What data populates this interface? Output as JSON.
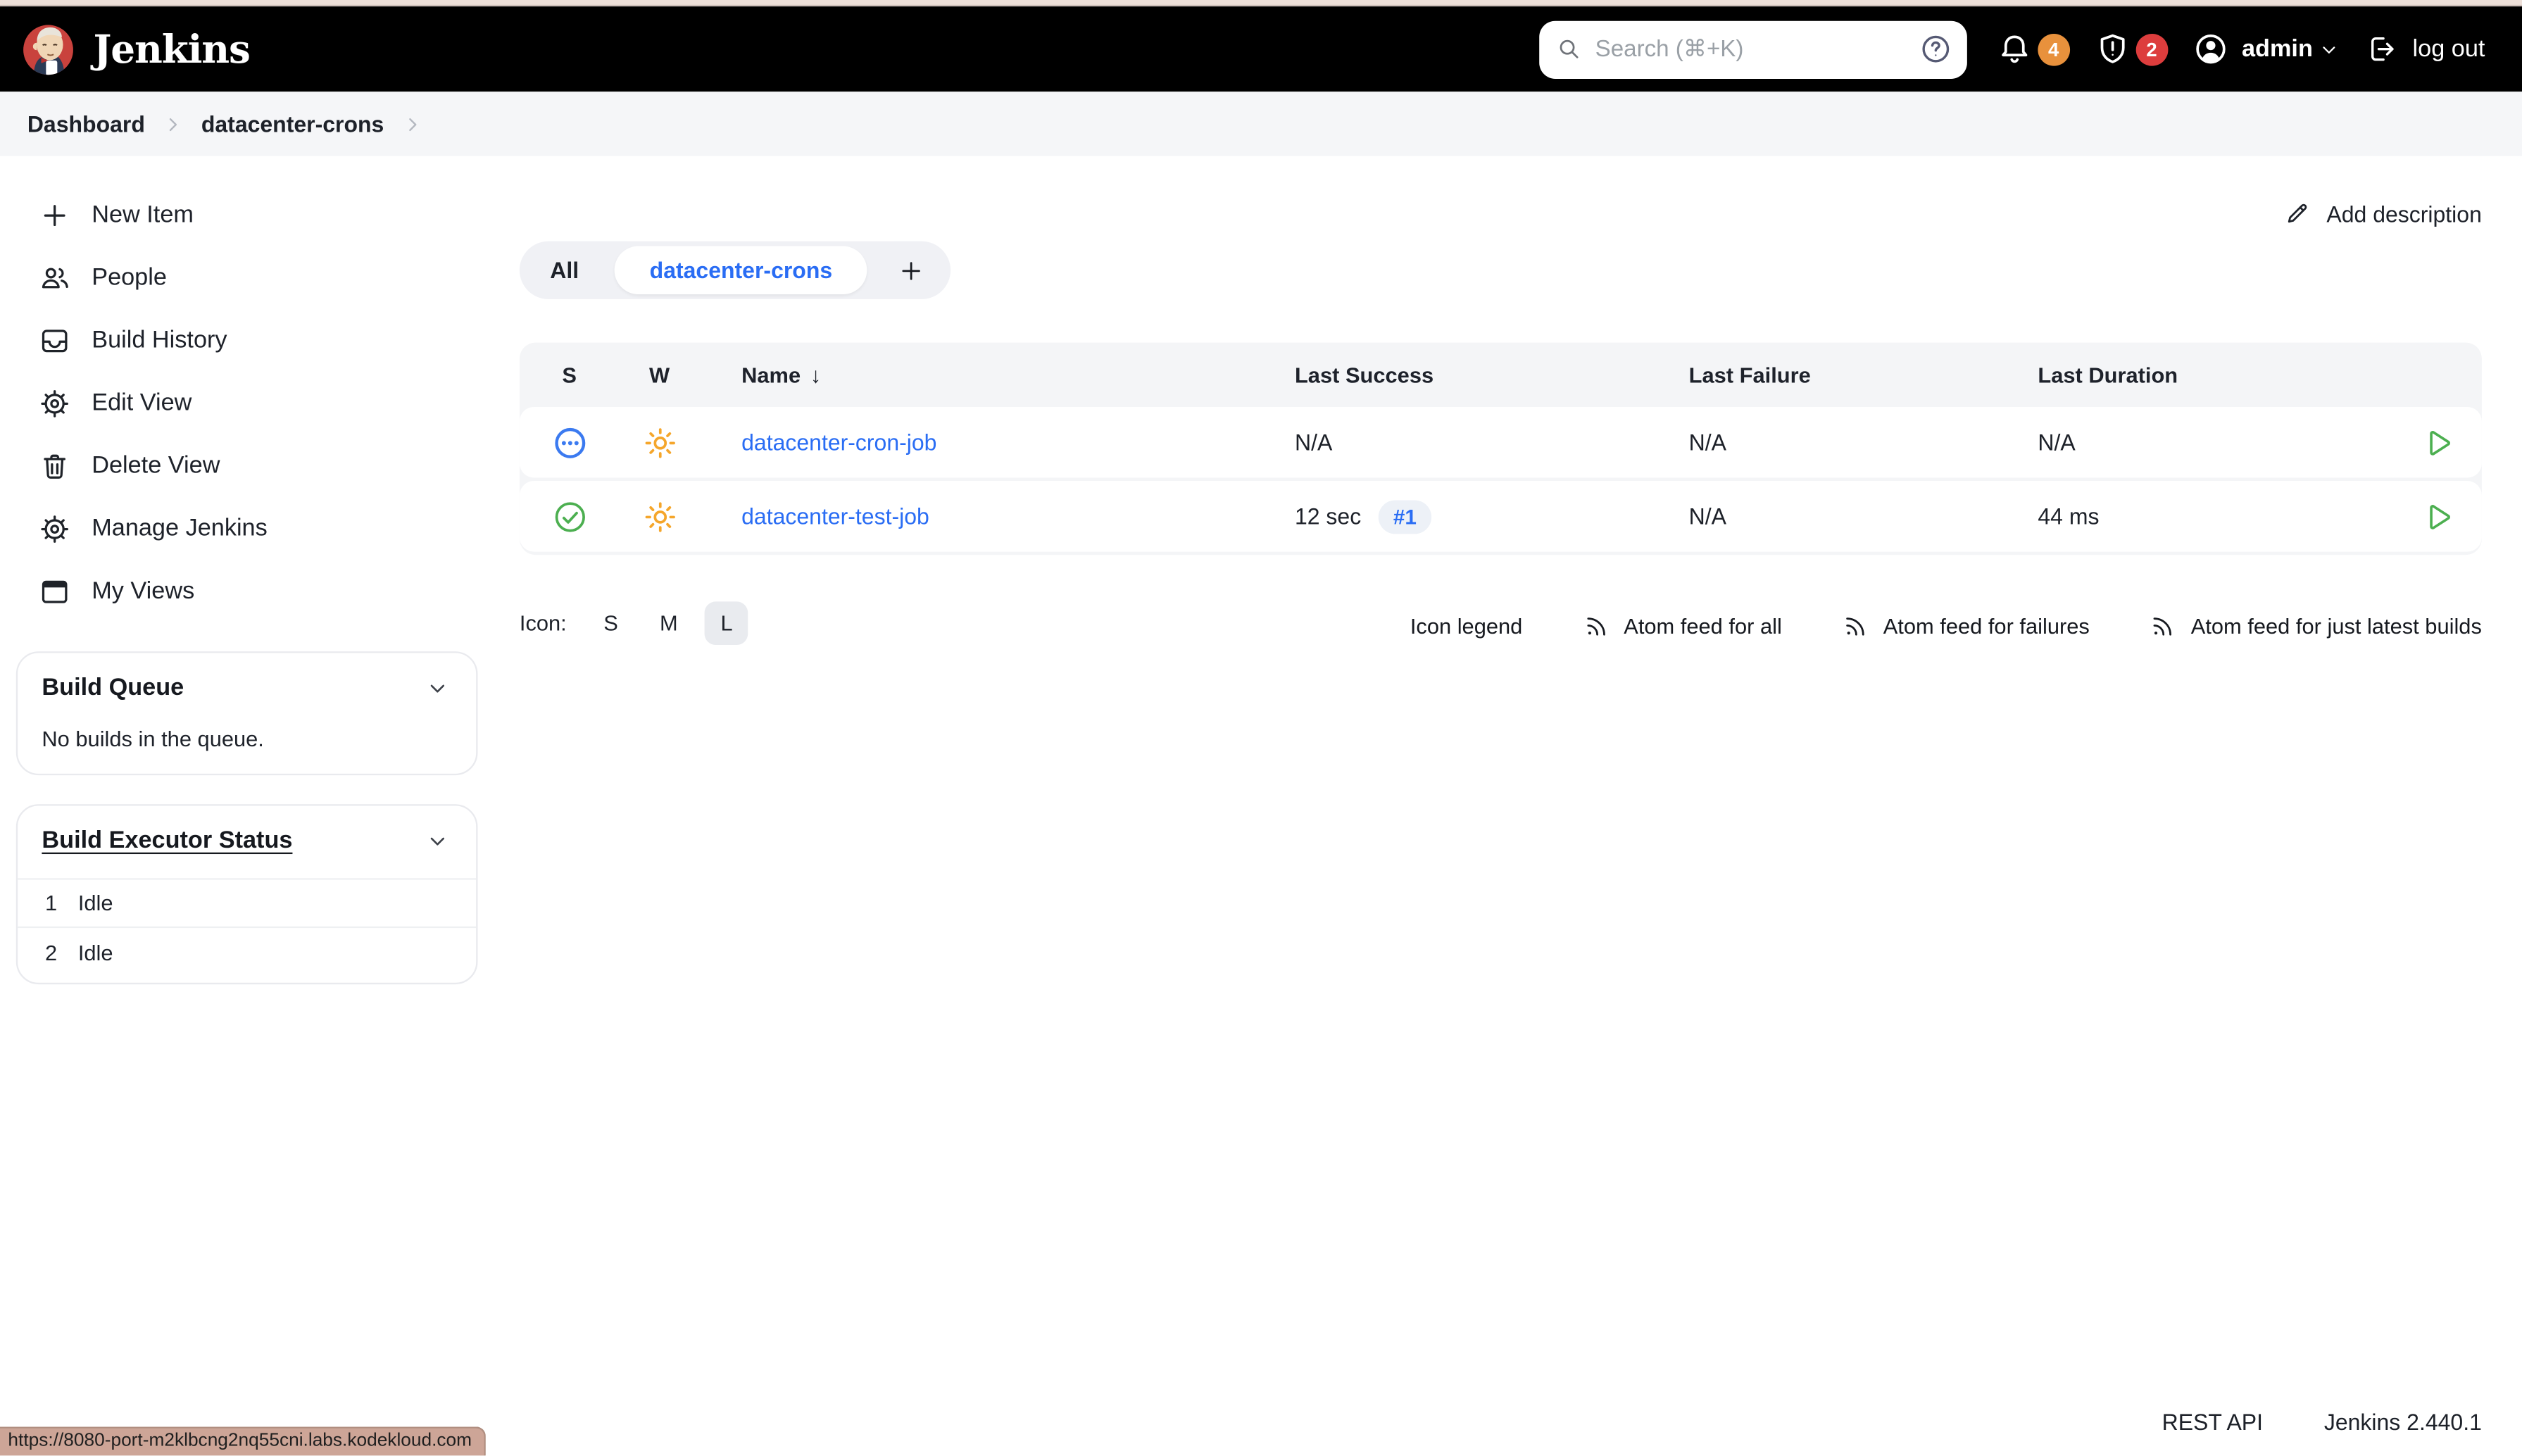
{
  "browser": {
    "status_url": "https://8080-port-m2klbcng2nq55cni.labs.kodekloud.com"
  },
  "header": {
    "brand": "Jenkins",
    "search_placeholder": "Search (⌘+K)",
    "notifications_count": "4",
    "security_warnings_count": "2",
    "user": "admin",
    "logout_label": "log out"
  },
  "breadcrumb": {
    "items": [
      "Dashboard",
      "datacenter-crons"
    ]
  },
  "sidebar": {
    "items": [
      {
        "label": "New Item",
        "icon": "plus-icon"
      },
      {
        "label": "People",
        "icon": "people-icon"
      },
      {
        "label": "Build History",
        "icon": "build-history-icon"
      },
      {
        "label": "Edit View",
        "icon": "gear-icon"
      },
      {
        "label": "Delete View",
        "icon": "trash-icon"
      },
      {
        "label": "Manage Jenkins",
        "icon": "gear-icon"
      },
      {
        "label": "My Views",
        "icon": "window-icon"
      }
    ],
    "build_queue": {
      "title": "Build Queue",
      "empty_text": "No builds in the queue."
    },
    "executor_status": {
      "title": "Build Executor Status",
      "executors": [
        {
          "number": "1",
          "state": "Idle"
        },
        {
          "number": "2",
          "state": "Idle"
        }
      ]
    }
  },
  "main": {
    "add_description_label": "Add description",
    "tabs": [
      {
        "label": "All",
        "active": false
      },
      {
        "label": "datacenter-crons",
        "active": true
      }
    ],
    "table": {
      "sort_arrow": "↓",
      "headers": {
        "s": "S",
        "w": "W",
        "name": "Name",
        "last_success": "Last Success",
        "last_failure": "Last Failure",
        "last_duration": "Last Duration"
      },
      "rows": [
        {
          "status": "never-built",
          "weather": "sunny",
          "name": "datacenter-cron-job",
          "last_success": "N/A",
          "build_badge": "",
          "last_failure": "N/A",
          "last_duration": "N/A"
        },
        {
          "status": "success",
          "weather": "sunny",
          "name": "datacenter-test-job",
          "last_success": "12 sec",
          "build_badge": "#1",
          "last_failure": "N/A",
          "last_duration": "44 ms"
        }
      ]
    },
    "icon_size": {
      "label": "Icon:",
      "options": [
        {
          "label": "S",
          "selected": false
        },
        {
          "label": "M",
          "selected": false
        },
        {
          "label": "L",
          "selected": true
        }
      ]
    },
    "icon_legend_label": "Icon legend",
    "atom_links": [
      {
        "label": "Atom feed for all"
      },
      {
        "label": "Atom feed for failures"
      },
      {
        "label": "Atom feed for just latest builds"
      }
    ]
  },
  "footer": {
    "rest_api": "REST API",
    "version": "Jenkins 2.440.1"
  },
  "colors": {
    "accent": "#2a6df4",
    "success": "#4caf50",
    "weather": "#f5a62b",
    "badge_orange": "#e8913c",
    "badge_red": "#dd3d3d",
    "top_strip": "#eddfd8",
    "status_bg": "#cda597"
  }
}
